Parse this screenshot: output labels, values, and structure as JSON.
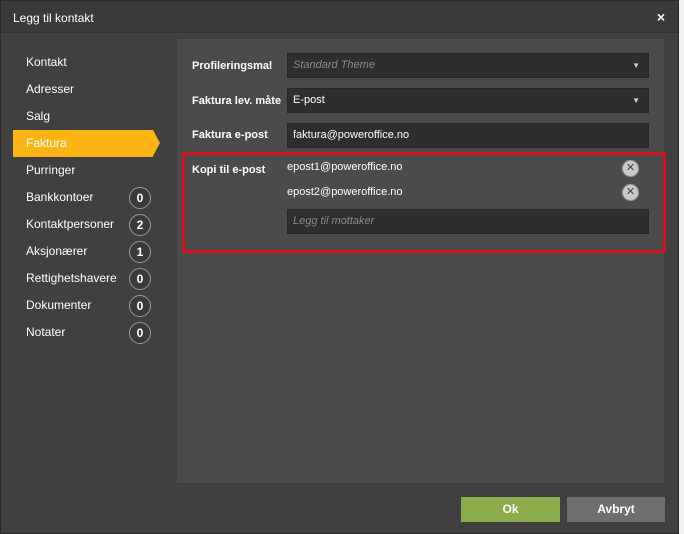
{
  "dialog": {
    "title": "Legg til kontakt",
    "close_glyph": "×"
  },
  "sidebar": {
    "items": [
      {
        "label": "Kontakt"
      },
      {
        "label": "Adresser"
      },
      {
        "label": "Salg"
      },
      {
        "label": "Faktura",
        "active": true
      },
      {
        "label": "Purringer"
      },
      {
        "label": "Bankkontoer",
        "count": "0"
      },
      {
        "label": "Kontaktpersoner",
        "count": "2"
      },
      {
        "label": "Aksjonærer",
        "count": "1"
      },
      {
        "label": "Rettighetshavere",
        "count": "0"
      },
      {
        "label": "Dokumenter",
        "count": "0"
      },
      {
        "label": "Notater",
        "count": "0"
      }
    ]
  },
  "form": {
    "profile_label": "Profileringsmal",
    "profile_placeholder": "Standard Theme",
    "delivery_label": "Faktura lev. måte",
    "delivery_value": "E-post",
    "invoice_email_label": "Faktura e-post",
    "invoice_email_value": "faktura@poweroffice.no",
    "cc_label": "Kopi til e-post",
    "cc_emails": [
      "epost1@poweroffice.no",
      "epost2@poweroffice.no"
    ],
    "cc_placeholder": "Legg til mottaker",
    "remove_glyph": "✕",
    "caret_glyph": "▼"
  },
  "buttons": {
    "ok": "Ok",
    "cancel": "Avbryt"
  },
  "colors": {
    "accent": "#fdb515",
    "ok_button": "#8bad4d",
    "highlight": "#d2141e"
  }
}
